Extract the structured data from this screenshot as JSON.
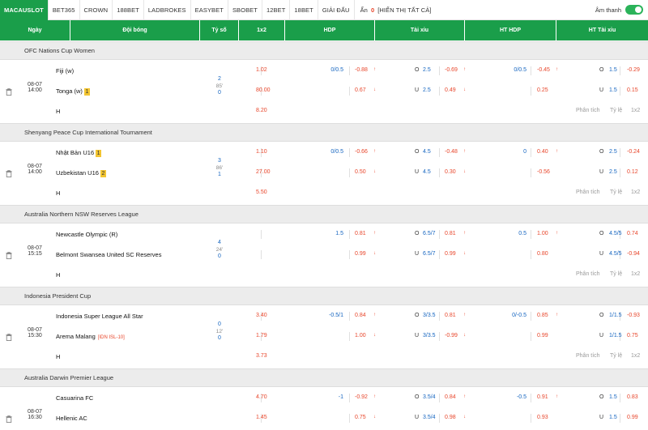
{
  "topbar": {
    "tabs": [
      "MACAUSLOT",
      "BET365",
      "CROWN",
      "188BET",
      "LADBROKES",
      "EASYBET",
      "SBOBET",
      "12BET",
      "18BET",
      "GIẢI ĐẤU"
    ],
    "hide_label": "Ẩn",
    "hide_count": "0",
    "show_all": "[HIỂN THỊ TẤT CẢ]",
    "sound_label": "Âm thanh"
  },
  "header": {
    "date": "Ngày",
    "teams": "Đội bóng",
    "score": "Tỷ số",
    "onex2": "1x2",
    "hdp": "HDP",
    "taixiu": "Tài xỉu",
    "ht_hdp": "HT HDP",
    "ht_taixiu": "HT Tài xỉu"
  },
  "links": {
    "analysis": "Phân tích",
    "odds": "Tỷ lệ",
    "onex2": "1x2"
  },
  "leagues": [
    {
      "name": "OFC Nations Cup Women",
      "match": {
        "date": "08-07",
        "time": "14:00",
        "home": "Fiji (w)",
        "home_badge": "",
        "away": "Tonga (w)",
        "away_badge": "1",
        "away_tag": "",
        "score_home": "2",
        "minute": "85'",
        "score_away": "0",
        "o1": "1.02",
        "ox": "80.00",
        "o2": "8.20",
        "hdp_line": "0/0.5",
        "hdp_h": "-0.88",
        "hdp_a": "0.67",
        "tx_line_h": "2.5",
        "tx_line_a": "2.5",
        "tx_h": "-0.69",
        "tx_a": "0.49",
        "hthdp_line": "0/0.5",
        "hthdp_h": "-0.45",
        "hthdp_a": "0.25",
        "httx_line_h": "1.5",
        "httx_line_a": "1.5",
        "httx_h": "-0.29",
        "httx_a": "0.15"
      }
    },
    {
      "name": "Shenyang Peace Cup International Tournament",
      "match": {
        "date": "08-07",
        "time": "14:00",
        "home": "Nhật Bản U16",
        "home_badge": "1",
        "away": "Uzbekistan U16",
        "away_badge": "2",
        "away_tag": "",
        "score_home": "3",
        "minute": "86'",
        "score_away": "1",
        "o1": "1.10",
        "ox": "27.00",
        "o2": "5.50",
        "hdp_line": "0/0.5",
        "hdp_h": "-0.66",
        "hdp_a": "0.50",
        "tx_line_h": "4.5",
        "tx_line_a": "4.5",
        "tx_h": "-0.48",
        "tx_a": "0.30",
        "hthdp_line": "0",
        "hthdp_h": "0.40",
        "hthdp_a": "-0.56",
        "httx_line_h": "2.5",
        "httx_line_a": "2.5",
        "httx_h": "-0.24",
        "httx_a": "0.12"
      }
    },
    {
      "name": "Australia Northern NSW Reserves League",
      "match": {
        "date": "08-07",
        "time": "15:15",
        "home": "Newcastle Olympic (R)",
        "home_badge": "",
        "away": "Belmont Swansea United SC Reserves",
        "away_badge": "",
        "away_tag": "",
        "score_home": "4",
        "minute": "24'",
        "score_away": "0",
        "o1": "",
        "ox": "",
        "o2": "",
        "hdp_line": "1.5",
        "hdp_h": "0.81",
        "hdp_a": "0.99",
        "tx_line_h": "6.5/7",
        "tx_line_a": "6.5/7",
        "tx_h": "0.81",
        "tx_a": "0.99",
        "hthdp_line": "0.5",
        "hthdp_h": "1.00",
        "hthdp_a": "0.80",
        "httx_line_h": "4.5/5",
        "httx_line_a": "4.5/5",
        "httx_h": "0.74",
        "httx_a": "-0.94"
      }
    },
    {
      "name": "Indonesia President Cup",
      "match": {
        "date": "08-07",
        "time": "15:30",
        "home": "Indonesia Super League All Star",
        "home_badge": "",
        "away": "Arema Malang",
        "away_badge": "",
        "away_tag": "[IDN ISL-10]",
        "score_home": "0",
        "minute": "12'",
        "score_away": "0",
        "o1": "3.40",
        "ox": "1.79",
        "o2": "3.73",
        "hdp_line": "-0.5/1",
        "hdp_h": "0.84",
        "hdp_a": "1.00",
        "tx_line_h": "3/3.5",
        "tx_line_a": "3/3.5",
        "tx_h": "0.81",
        "tx_a": "-0.99",
        "hthdp_line": "0/-0.5",
        "hthdp_h": "0.85",
        "hthdp_a": "0.99",
        "httx_line_h": "1/1.5",
        "httx_line_a": "1/1.5",
        "httx_h": "-0.93",
        "httx_a": "0.75"
      }
    },
    {
      "name": "Australia Darwin Premier League",
      "match": {
        "date": "08-07",
        "time": "16:30",
        "home": "Casuarina FC",
        "home_badge": "",
        "away": "Hellenic AC",
        "away_badge": "",
        "away_tag": "",
        "score_home": "",
        "minute": "",
        "score_away": "",
        "o1": "4.70",
        "ox": "1.45",
        "o2": "",
        "hdp_line": "-1",
        "hdp_h": "-0.92",
        "hdp_a": "0.75",
        "tx_line_h": "3.5/4",
        "tx_line_a": "3.5/4",
        "tx_h": "0.84",
        "tx_a": "0.98",
        "hthdp_line": "-0.5",
        "hthdp_h": "0.91",
        "hthdp_a": "0.93",
        "httx_line_h": "1.5",
        "httx_line_a": "1.5",
        "httx_h": "0.83",
        "httx_a": "0.99"
      }
    }
  ]
}
